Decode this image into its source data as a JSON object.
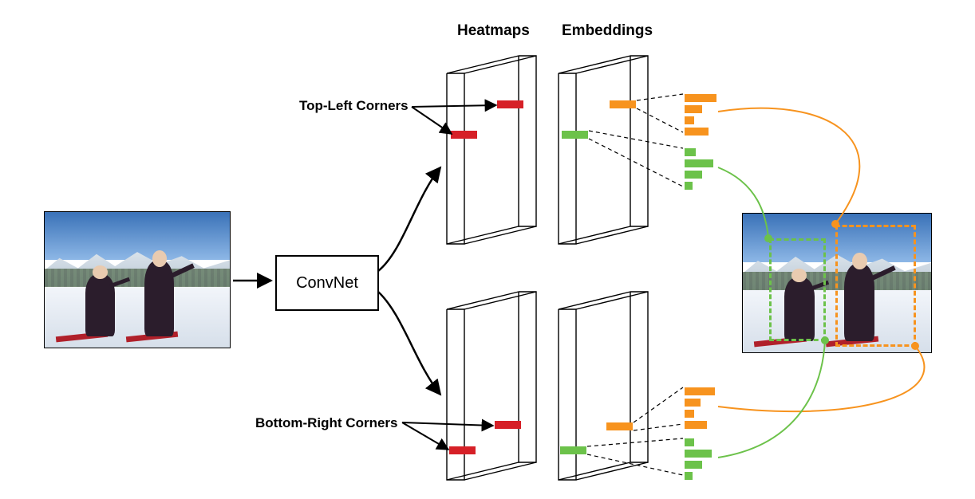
{
  "labels": {
    "heatmaps": "Heatmaps",
    "embeddings": "Embeddings",
    "top_left_corners": "Top-Left Corners",
    "bottom_right_corners": "Bottom-Right Corners",
    "convnet": "ConvNet"
  },
  "colors": {
    "heatmap_marker": "#d62027",
    "embedding_a": "#f7931e",
    "embedding_b": "#6cc24a",
    "stroke": "#000000"
  },
  "diagram": {
    "components": [
      "input-image",
      "convnet",
      "heatmaps-top-left",
      "heatmaps-bottom-right",
      "embeddings-top-left",
      "embeddings-bottom-right",
      "embedding-vectors",
      "output-image-with-detections"
    ],
    "corner_types": [
      "Top-Left Corners",
      "Bottom-Right Corners"
    ],
    "detections": [
      {
        "id": "person-left",
        "color": "green",
        "tl_source": "embeddings-top-left",
        "br_source": "embeddings-bottom-right"
      },
      {
        "id": "person-right",
        "color": "orange",
        "tl_source": "embeddings-top-left",
        "br_source": "embeddings-bottom-right"
      }
    ]
  }
}
